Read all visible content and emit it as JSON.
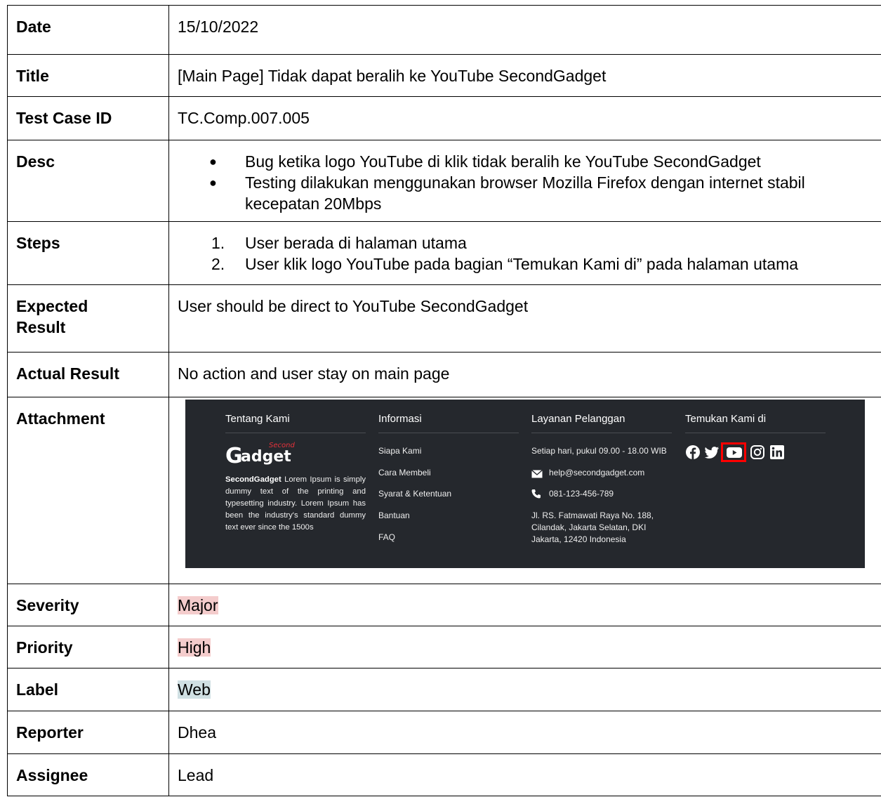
{
  "rows": {
    "date": {
      "label": "Date",
      "value": "15/10/2022"
    },
    "title": {
      "label": "Title",
      "value": "[Main Page] Tidak dapat beralih ke YouTube SecondGadget"
    },
    "test_case_id": {
      "label": "Test Case ID",
      "value": "TC.Comp.007.005"
    },
    "desc": {
      "label": "Desc",
      "items": [
        "Bug ketika logo YouTube di klik tidak beralih ke YouTube SecondGadget",
        "Testing dilakukan menggunakan browser Mozilla Firefox dengan internet stabil kecepatan 20Mbps"
      ]
    },
    "steps": {
      "label": "Steps",
      "items": [
        "User berada di halaman utama",
        "User klik logo YouTube pada bagian “Temukan Kami di” pada halaman utama"
      ]
    },
    "expected": {
      "label_line1": "Expected",
      "label_line2": "Result",
      "value": "User should be direct to YouTube SecondGadget"
    },
    "actual": {
      "label": "Actual Result",
      "value": "No action and user stay on main page"
    },
    "attachment": {
      "label": "Attachment"
    },
    "severity": {
      "label": "Severity",
      "value": "Major"
    },
    "priority": {
      "label": "Priority",
      "value": "High"
    },
    "label": {
      "label": "Label",
      "value": "Web"
    },
    "reporter": {
      "label": "Reporter",
      "value": "Dhea"
    },
    "assignee": {
      "label": "Assignee",
      "value": "Lead"
    }
  },
  "attachment_footer": {
    "about": {
      "heading": "Tentang Kami",
      "logo_small": "Second",
      "logo_g": "G",
      "logo_main": "adget",
      "brand": "SecondGadget",
      "text": "Lorem Ipsum is simply dummy text of the printing and typesetting industry. Lorem Ipsum has been the industry's standard dummy text ever since the 1500s"
    },
    "info": {
      "heading": "Informasi",
      "links": [
        "Siapa Kami",
        "Cara Membeli",
        "Syarat & Ketentuan",
        "Bantuan",
        "FAQ"
      ]
    },
    "service": {
      "heading": "Layanan Pelanggan",
      "hours": "Setiap hari, pukul 09.00 - 18.00 WIB",
      "email": "help@secondgadget.com",
      "phone": "081-123-456-789",
      "address_line1": "Jl. RS. Fatmawati Raya No. 188,",
      "address_line2": "Cilandak, Jakarta Selatan, DKI",
      "address_line3": "Jakarta, 12420 Indonesia"
    },
    "find": {
      "heading": "Temukan Kami di",
      "icons": [
        "facebook-icon",
        "twitter-icon",
        "youtube-icon",
        "instagram-icon",
        "linkedin-icon"
      ]
    }
  },
  "colors": {
    "footer_bg": "#25282d",
    "highlight_red": "#f4cccc",
    "highlight_blue": "#d0e0e3",
    "annotation_box": "#ff0000",
    "brand_accent": "#e8323b"
  }
}
